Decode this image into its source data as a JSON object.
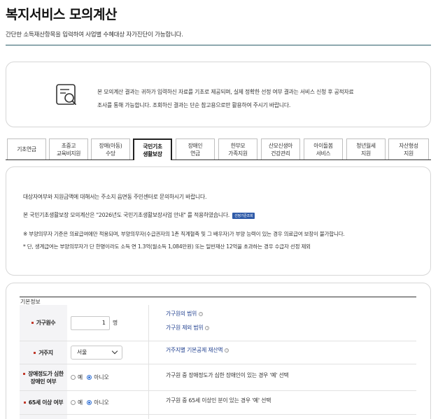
{
  "header": {
    "title": "복지서비스 모의계산",
    "description": "간단한 소득재산항목을 입력하여 사업별 수혜대상 자가진단이 가능합니다."
  },
  "notice": {
    "icon": "document-search-icon",
    "line1": "본 모의계산 결과는 귀하가 입력하신 자료를 기초로 제공되며, 실제 정확한 선정 여부 결과는 서비스 신청 후 공적자료",
    "line2": "조사를 통해 가능합니다. 조회하신 결과는 단순 참고용으로만 활용하여 주시기 바랍니다."
  },
  "tabs": [
    {
      "line1": "기초연금",
      "line2": ""
    },
    {
      "line1": "초중고",
      "line2": "교육비지원"
    },
    {
      "line1": "장애(아동)",
      "line2": "수당"
    },
    {
      "line1": "국민기초",
      "line2": "생활보장"
    },
    {
      "line1": "장애인",
      "line2": "연금"
    },
    {
      "line1": "한부모",
      "line2": "가족지원"
    },
    {
      "line1": "산모신생아",
      "line2": "건강관리"
    },
    {
      "line1": "아이돌봄",
      "line2": "서비스"
    },
    {
      "line1": "청년월세",
      "line2": "지원"
    },
    {
      "line1": "자산형성",
      "line2": "지원"
    }
  ],
  "active_tab": "국민기초 생활보장",
  "info": {
    "line1": "대상자여부와 지원금액에 대해서는 주소지 읍면동 주민센터로 문의하시기 바랍니다.",
    "line2": "본 국민기초생활보장 모의계산은 \"2026년도 국민기초생활보장사업 안내\" 를 적용하였습니다.",
    "badge": "선정기준조회",
    "line3": "※ 부양의무자 기준은 의료급여에만 적용되며, 부양의무자(수급권자의 1촌 직계혈족 및 그 배우자)가 부양 능력이 있는 경우 의료급여 보장이 불가합니다.",
    "line4": "* 단, 생계급여는 부양의무자가 단 한명이라도 소득 연 1.3억(월소득 1,084만원) 또는 일반재산 12억을 초과하는 경우 수급자 선정 제외"
  },
  "form": {
    "section_title": "기본정보",
    "household": {
      "label": "가구원수",
      "value": "1",
      "unit": "명",
      "help1": "가구원의 범위",
      "help2": "가구원 제외 범위"
    },
    "residence": {
      "label": "거주지",
      "value": "서울",
      "help": "거주지별 기본공제 재산액"
    },
    "severe_disability": {
      "label_line1": "장애정도가 심한",
      "label_line2": "장애인 여부",
      "option_yes": "예",
      "option_no": "아니오",
      "selected": "아니오",
      "help": "가구원 중 장애정도가 심한 장애인이 있는 경우 '예' 선택"
    },
    "senior": {
      "label": "65세 이상 여부",
      "option_yes": "예",
      "option_no": "아니오",
      "selected": "아니오",
      "help": "가구원 중 65세 이상인 분이 있는 경우 '예' 선택"
    }
  },
  "colors": {
    "title_rule": "#2d5f6a",
    "link": "#1f3f8f",
    "required_bullet": "#c0392b",
    "radio_checked": "#2e6fd6",
    "badge_bg": "#2e5aa8"
  }
}
